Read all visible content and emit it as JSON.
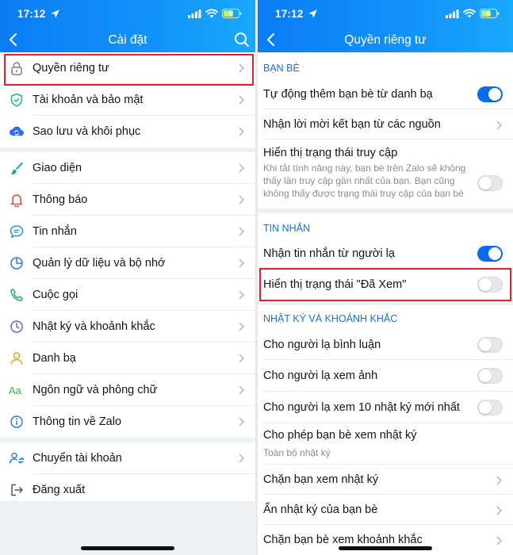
{
  "status_bar": {
    "time": "17:12"
  },
  "left": {
    "title": "Cài đặt",
    "groups": [
      [
        {
          "label": "Quyền riêng tư",
          "icon": "lock-icon"
        },
        {
          "label": "Tài khoản và bảo mật",
          "icon": "shield-icon"
        },
        {
          "label": "Sao lưu và khôi phục",
          "icon": "cloud-sync-icon"
        }
      ],
      [
        {
          "label": "Giao diện",
          "icon": "brush-icon"
        },
        {
          "label": "Thông báo",
          "icon": "bell-icon"
        },
        {
          "label": "Tin nhắn",
          "icon": "chat-icon"
        },
        {
          "label": "Quản lý dữ liệu và bộ nhớ",
          "icon": "pie-chart-icon"
        },
        {
          "label": "Cuộc gọi",
          "icon": "phone-icon"
        },
        {
          "label": "Nhật ký và khoảnh khắc",
          "icon": "clock-icon"
        },
        {
          "label": "Danh bạ",
          "icon": "person-icon"
        },
        {
          "label": "Ngôn ngữ và phông chữ",
          "icon": "aa-font-icon"
        },
        {
          "label": "Thông tin về Zalo",
          "icon": "info-icon"
        }
      ],
      [
        {
          "label": "Chuyển tài khoản",
          "icon": "switch-user-icon"
        },
        {
          "label": "Đăng xuất",
          "icon": "logout-icon"
        }
      ]
    ]
  },
  "right": {
    "title": "Quyền riêng tư",
    "friends": {
      "header": "BẠN BÈ",
      "auto_add": {
        "label": "Tự động thêm bạn bè từ danh bạ",
        "toggle": true
      },
      "invites": {
        "label": "Nhận lời mời kết bạn từ các nguồn"
      },
      "access": {
        "label": "Hiển thị trạng thái truy cập",
        "desc": "Khi tắt tính năng này, bạn bè trên Zalo sẽ không thấy lần truy cập gần nhất của bạn. Bạn cũng không thấy được trạng thái truy cập của bạn bè",
        "toggle": false
      }
    },
    "messages": {
      "header": "TIN NHẮN",
      "strangers": {
        "label": "Nhận tin nhắn từ người lạ",
        "toggle": true
      },
      "seen": {
        "label": "Hiển thị trạng thái \"Đã Xem\"",
        "toggle": false
      }
    },
    "diary": {
      "header": "NHẬT KÝ VÀ KHOẢNH KHẮC",
      "comment": {
        "label": "Cho người lạ bình luận",
        "toggle": false
      },
      "photos": {
        "label": "Cho người lạ xem ảnh",
        "toggle": false
      },
      "recent": {
        "label": "Cho người lạ xem 10 nhật ký mới nhất",
        "toggle": false
      },
      "allow": {
        "label": "Cho phép bạn bè xem nhật ký",
        "value": "Toàn bộ nhật ký"
      },
      "block": {
        "label": "Chặn bạn xem nhật ký"
      },
      "hide": {
        "label": "Ẩn nhật ký của bạn bè"
      },
      "block_moments": {
        "label": "Chặn bạn bè xem khoảnh khắc"
      }
    }
  },
  "colors": {
    "header": "#0a7df5",
    "accent": "#0a6cf0",
    "highlight": "#d9222b",
    "section": "#1a6fe0"
  }
}
